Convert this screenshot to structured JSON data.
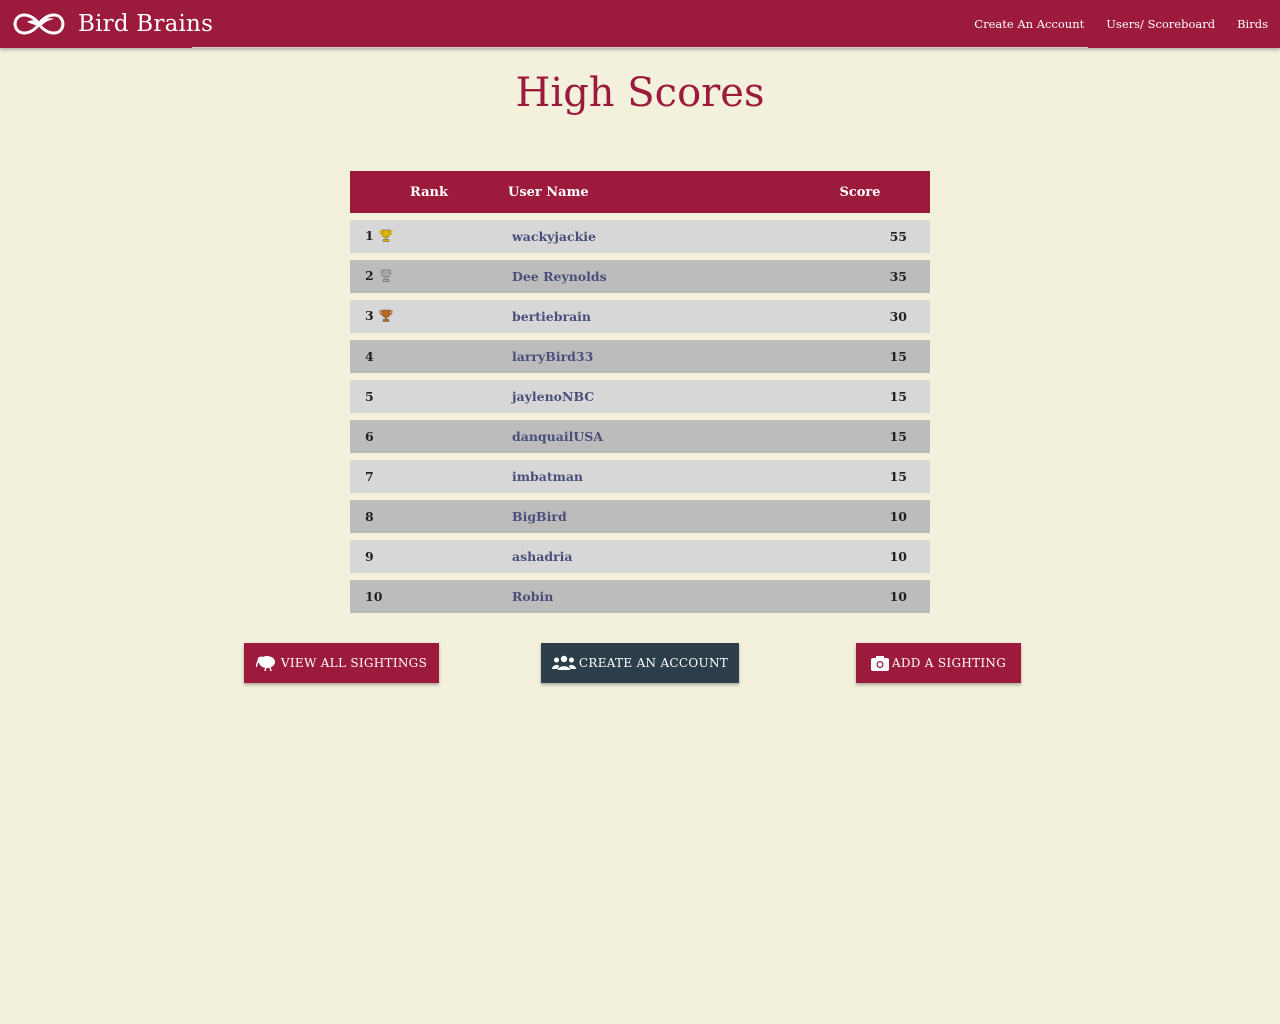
{
  "nav": {
    "brand": "Bird Brains",
    "links": [
      "Create An Account",
      "Users/ Scoreboard",
      "Birds"
    ]
  },
  "page": {
    "title": "High Scores"
  },
  "table": {
    "headers": {
      "rank": "Rank",
      "user": "User Name",
      "score": "Score"
    },
    "rows": [
      {
        "rank": "1",
        "user": "wackyjackie",
        "score": "55",
        "trophy": "gold"
      },
      {
        "rank": "2",
        "user": "Dee Reynolds",
        "score": "35",
        "trophy": "silver"
      },
      {
        "rank": "3",
        "user": "bertiebrain",
        "score": "30",
        "trophy": "bronze"
      },
      {
        "rank": "4",
        "user": "larryBird33",
        "score": "15"
      },
      {
        "rank": "5",
        "user": "jaylenoNBC",
        "score": "15"
      },
      {
        "rank": "6",
        "user": "danquailUSA",
        "score": "15"
      },
      {
        "rank": "7",
        "user": "imbatman",
        "score": "15"
      },
      {
        "rank": "8",
        "user": "BigBird",
        "score": "10"
      },
      {
        "rank": "9",
        "user": "ashadria",
        "score": "10"
      },
      {
        "rank": "10",
        "user": "Robin",
        "score": "10"
      }
    ]
  },
  "buttons": {
    "view_sightings": "VIEW ALL SIGHTINGS",
    "create_account": "CREATE AN ACCOUNT",
    "add_sighting": "ADD A SIGHTING"
  },
  "icons": {
    "trophy_gold": "#e0b300",
    "trophy_silver": "#a9a9a9",
    "trophy_bronze": "#b86b1c"
  },
  "colors": {
    "brand": "#9c1a3c",
    "secondary": "#2b3e4a",
    "background": "#f3f0dc"
  }
}
